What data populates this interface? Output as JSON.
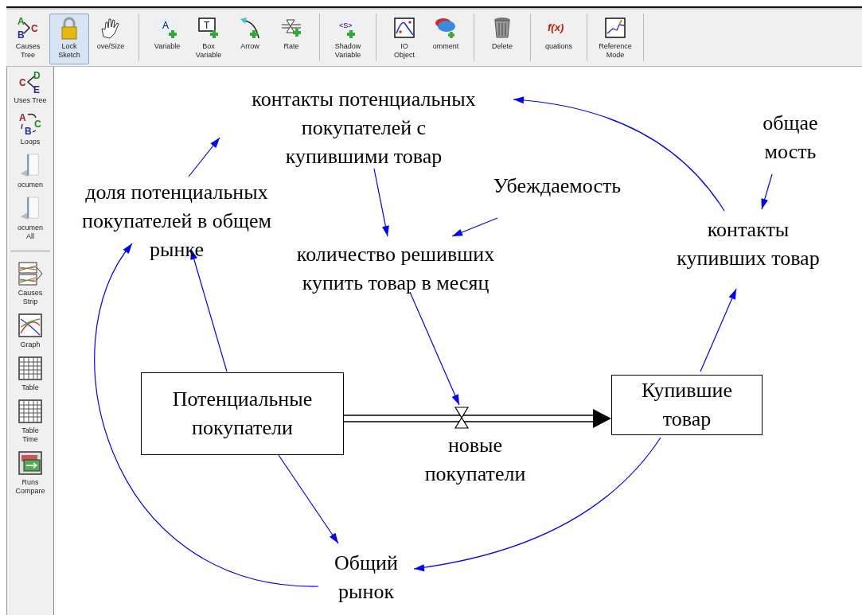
{
  "toolbar": [
    {
      "label": "Causes\nTree",
      "selected": false,
      "glyphs": [
        "A",
        "B",
        "C"
      ]
    },
    {
      "label": "Lock\nSketch",
      "selected": true
    },
    {
      "label": "ove/Size",
      "selected": false
    },
    {
      "label": "Variable",
      "selected": false,
      "glyphs": [
        "A"
      ]
    },
    {
      "label": "Box\nVariable",
      "selected": false,
      "glyphs": [
        "T"
      ]
    },
    {
      "label": "Arrow",
      "selected": false
    },
    {
      "label": "Rate",
      "selected": false
    },
    {
      "label": "Shadow\nVariable",
      "selected": false,
      "glyphs": [
        "<S>"
      ]
    },
    {
      "label": "IO\nObject",
      "selected": false
    },
    {
      "label": "omment",
      "selected": false
    },
    {
      "label": "Delete",
      "selected": false
    },
    {
      "label": "quations",
      "selected": false,
      "glyphs": [
        "f(x)"
      ]
    },
    {
      "label": "Reference\nMode",
      "selected": false
    }
  ],
  "sidebar": [
    {
      "label": "Uses Tree",
      "glyphs": [
        "C",
        "D",
        "E"
      ]
    },
    {
      "label": "Loops",
      "glyphs": [
        "A",
        "B",
        "C"
      ]
    },
    {
      "label": "ocumen"
    },
    {
      "label": "ocumen\nAll"
    },
    {
      "label": "Causes\nStrip"
    },
    {
      "label": "Graph"
    },
    {
      "label": "Table"
    },
    {
      "label": "Table\nTime"
    },
    {
      "label": "Runs\nCompare"
    }
  ],
  "diagram": {
    "nodes": [
      {
        "kind": "variable",
        "text": "контакты потенциальных\nпокупателей с\nкупившими товар"
      },
      {
        "kind": "variable",
        "text": "общае\nмость"
      },
      {
        "kind": "variable",
        "text": "Убеждаемость"
      },
      {
        "kind": "variable",
        "text": "доля потенциальных\nпокупателей в общем\nрынке"
      },
      {
        "kind": "variable",
        "text": "контакты\nкупивших товар"
      },
      {
        "kind": "variable",
        "text": "количество решивших\nкупить товар в месяц"
      },
      {
        "kind": "stock",
        "text": "Потенциальные\nпокупатели"
      },
      {
        "kind": "stock",
        "text": "Купившие\nтовар"
      },
      {
        "kind": "rate",
        "text": "новые\nпокупатели"
      },
      {
        "kind": "variable",
        "text": "Общий\nрынок"
      }
    ]
  }
}
